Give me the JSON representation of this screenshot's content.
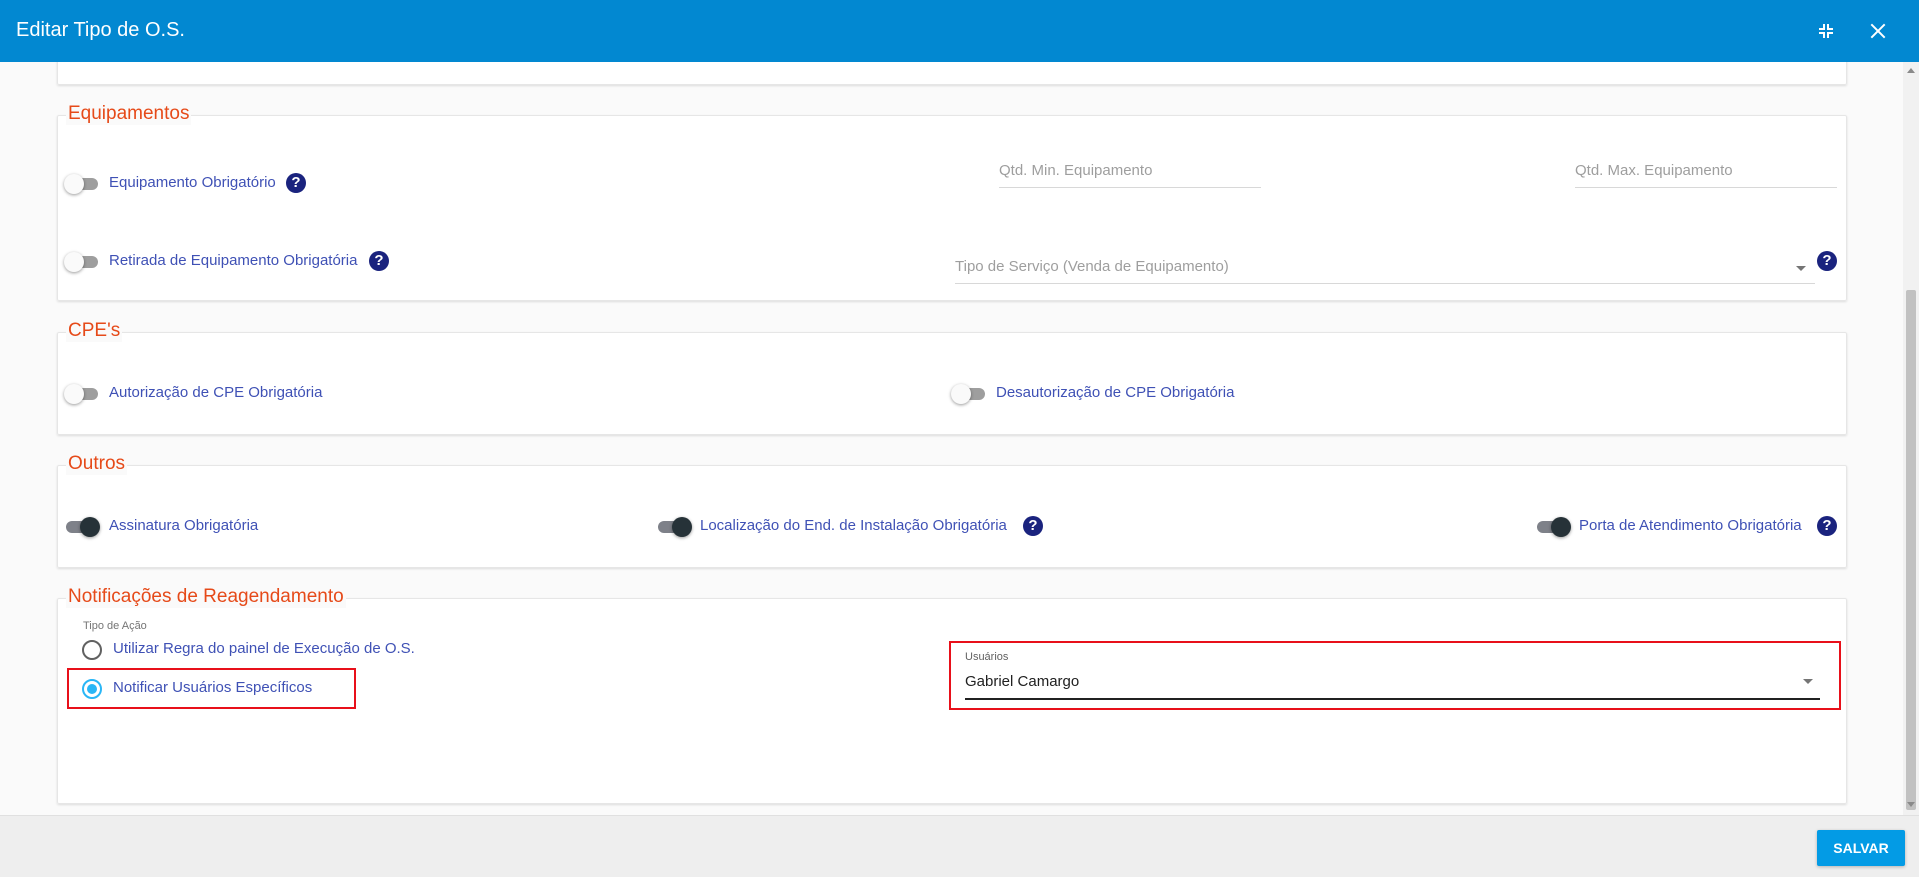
{
  "window": {
    "title": "Editar Tipo de O.S.",
    "header_color": "#0288d1"
  },
  "sections": {
    "equipamentos": {
      "legend": "Equipamentos",
      "equipamento_obrigatorio": {
        "label": "Equipamento Obrigatório",
        "enabled": false
      },
      "qtd_min": {
        "placeholder": "Qtd. Min. Equipamento"
      },
      "qtd_max": {
        "placeholder": "Qtd. Max. Equipamento"
      },
      "retirada_obrigatoria": {
        "label": "Retirada de Equipamento Obrigatória",
        "enabled": false
      },
      "tipo_servico": {
        "placeholder": "Tipo de Serviço (Venda de Equipamento)"
      }
    },
    "cpes": {
      "legend": "CPE's",
      "autorizacao": {
        "label": "Autorização de CPE Obrigatória",
        "enabled": false
      },
      "desautorizacao": {
        "label": "Desautorização de CPE Obrigatória",
        "enabled": false
      }
    },
    "outros": {
      "legend": "Outros",
      "assinatura": {
        "label": "Assinatura Obrigatória",
        "enabled": true
      },
      "localizacao": {
        "label": "Localização do End. de Instalação Obrigatória",
        "enabled": true
      },
      "porta": {
        "label": "Porta de Atendimento Obrigatória",
        "enabled": true
      }
    },
    "notificacoes": {
      "legend": "Notificações de Reagendamento",
      "tipo_acao_label": "Tipo de Ação",
      "options": [
        {
          "label": "Utilizar Regra do painel de Execução de O.S.",
          "selected": false
        },
        {
          "label": "Notificar Usuários Específicos",
          "selected": true
        }
      ],
      "usuarios": {
        "label": "Usuários",
        "value": "Gabriel Camargo"
      }
    }
  },
  "help_glyph": "?",
  "footer": {
    "save_label": "SALVAR"
  },
  "colors": {
    "legend": "#e64a19",
    "label": "#3f51b5",
    "radio_accent": "#29b6f6",
    "highlight": "#e8101a",
    "save_button": "#039be5"
  }
}
